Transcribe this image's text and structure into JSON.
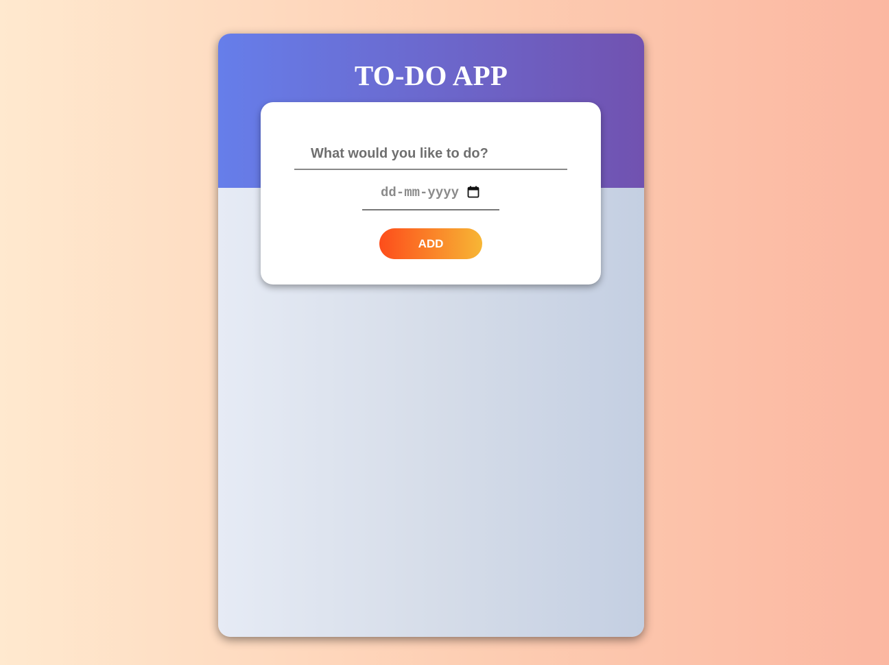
{
  "app": {
    "title": "TO-DO APP"
  },
  "form": {
    "task_placeholder": "What would you like to do?",
    "task_value": "",
    "date_placeholder": "dd-mm-yyyy",
    "date_icon": "calendar-icon",
    "add_label": "ADD"
  },
  "colors": {
    "header_gradient": [
      "#667eea",
      "#7152b0"
    ],
    "button_gradient": [
      "#fd4d1b",
      "#f7b635"
    ],
    "page_background": [
      "#ffe9cf",
      "#fbb7a1"
    ]
  }
}
